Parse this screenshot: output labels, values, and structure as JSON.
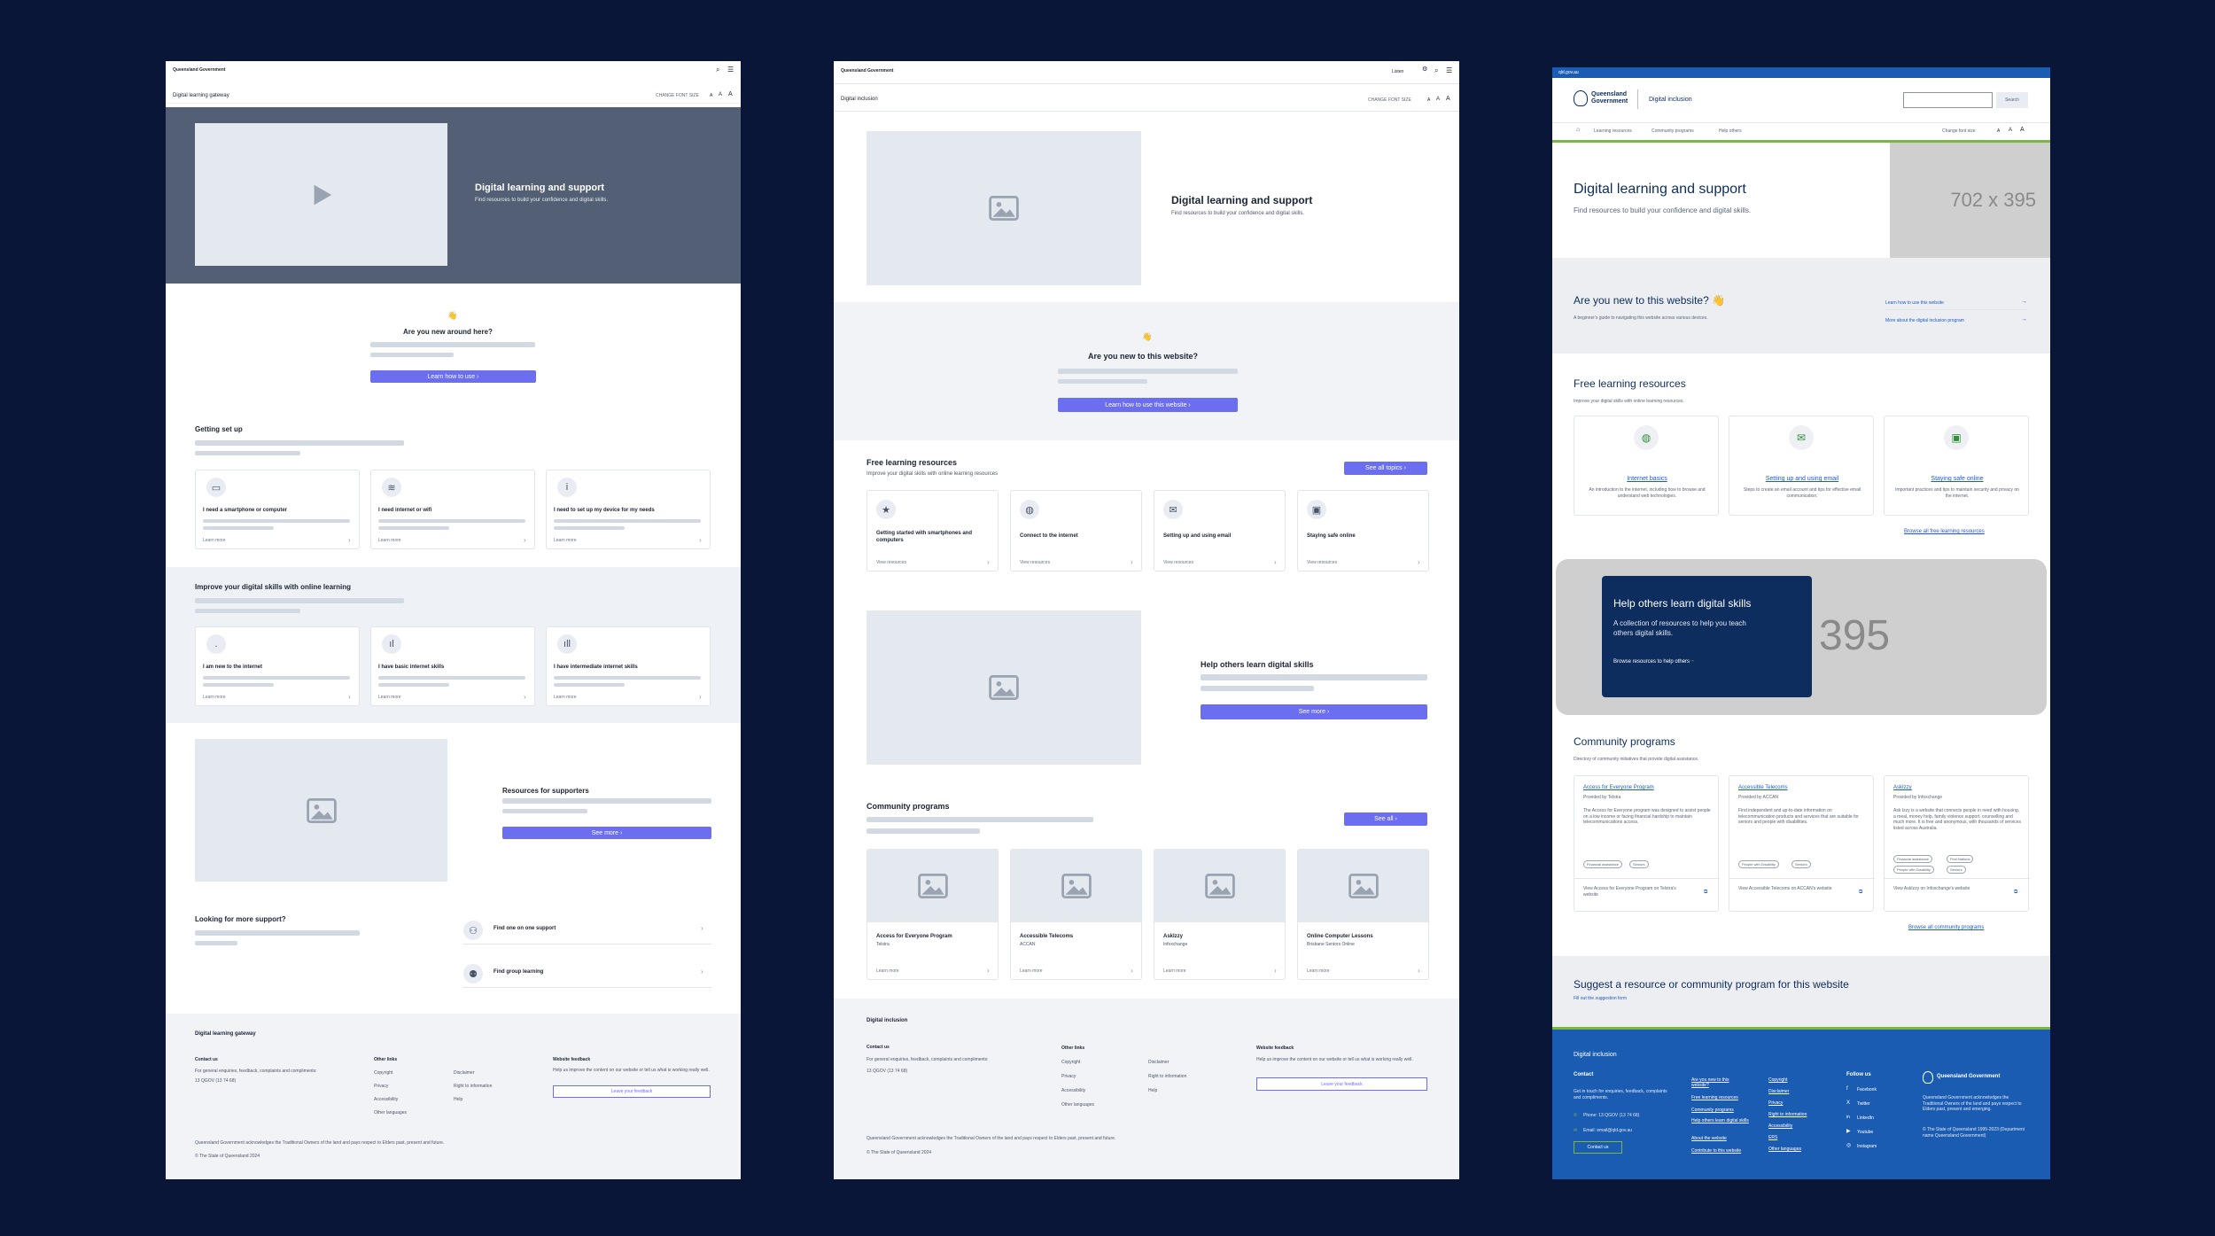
{
  "colors": {
    "background": "#0a1638",
    "accent": "#6c6ef0",
    "qld_blue": "#1b5cb3",
    "qld_navy": "#0c2d5e",
    "qld_green": "#78b843"
  },
  "icons": {
    "play": "play-icon",
    "image": "image-icon",
    "search": "search-icon",
    "menu": "menu-icon",
    "home": "home-icon"
  },
  "w1": {
    "logo": "Queensland Government",
    "site": "Digital learning gateway",
    "font_label": "CHANGE FONT SIZE",
    "font_a": [
      "A",
      "A",
      "A"
    ],
    "hero_title": "Digital learning and support",
    "hero_sub": "Find resources to build your confidence and digital skills.",
    "wave": "👋",
    "new_title": "Are you new around here?",
    "new_btn": "Learn how to use  ›",
    "setup_title": "Getting set up",
    "setup_cards": [
      {
        "label": "I need a smartphone or computer",
        "link": "Learn more"
      },
      {
        "label": "I need internet or wifi",
        "link": "Learn more"
      },
      {
        "label": "I need to set up my device for my needs",
        "link": "Learn more"
      }
    ],
    "improve_title": "Improve your digital skills with online learning",
    "improve_cards": [
      {
        "label": "I am new to the internet",
        "link": "Learn more"
      },
      {
        "label": "I have basic internet skills",
        "link": "Learn more"
      },
      {
        "label": "I have intermediate internet skills",
        "link": "Learn more"
      }
    ],
    "supporters_title": "Resources for supporters",
    "supporters_btn": "See more  ›",
    "more_title": "Looking for more support?",
    "support_links": [
      "Find one on one support",
      "Find group learning"
    ],
    "footer": {
      "site": "Digital learning gateway",
      "contact_h": "Contact us",
      "contact_text": "For general enquiries, feedback, complaints and compliments:",
      "phone": "13 QGOV (13 74 68)",
      "other_h": "Other links",
      "links_a": [
        "Copyright",
        "Privacy",
        "Accessibility",
        "Other languages"
      ],
      "links_b": [
        "Disclaimer",
        "Right to information",
        "Help"
      ],
      "feedback_h": "Website feedback",
      "feedback_text": "Help us improve the content on our website or tell us what is working really well.",
      "feedback_btn": "Leave your feedback",
      "ack": "Queensland Government acknowledges the Traditional Owners of the land and pays respect to Elders past, present and future.",
      "copy": "© The State of Queensland 2024"
    }
  },
  "w2": {
    "logo": "Queensland Government",
    "site": "Digital inclusion",
    "listen": "Listen",
    "font_label": "CHANGE FONT SIZE",
    "font_a": [
      "A",
      "A",
      "A"
    ],
    "hero_title": "Digital learning and support",
    "hero_sub": "Find resources to build your confidence and digital skills.",
    "wave": "👋",
    "new_title": "Are you new to this website?",
    "new_btn": "Learn how to use this website  ›",
    "free_title": "Free learning resources",
    "free_sub": "Improve your digital skills with online learning resources",
    "free_btn": "See all topics  ›",
    "free_cards": [
      {
        "label": "Getting started with smartphones and computers",
        "link": "View resources"
      },
      {
        "label": "Connect to the internet",
        "link": "View resources"
      },
      {
        "label": "Setting up and using email",
        "link": "View resources"
      },
      {
        "label": "Staying safe online",
        "link": "View resources"
      }
    ],
    "help_title": "Help others learn digital skills",
    "help_btn": "See more  ›",
    "comm_title": "Community programs",
    "comm_btn": "See all  ›",
    "comm_cards": [
      {
        "title": "Access for Everyone Program",
        "sub": "Telstra",
        "link": "Learn more"
      },
      {
        "title": "Accessible Telecoms",
        "sub": "ACCAN",
        "link": "Learn more"
      },
      {
        "title": "AskIzzy",
        "sub": "Infoxchange",
        "link": "Learn more"
      },
      {
        "title": "Online Computer Lessons",
        "sub": "Brisbane Seniors Online",
        "link": "Learn more"
      }
    ],
    "footer": {
      "site": "Digital inclusion",
      "contact_h": "Contact us",
      "contact_text": "For general enquiries, feedback, complaints and compliments:",
      "phone": "13 QGOV (13 74 68)",
      "other_h": "Other links",
      "links_a": [
        "Copyright",
        "Privacy",
        "Accessibility",
        "Other languages"
      ],
      "links_b": [
        "Disclaimer",
        "Right to information",
        "Help"
      ],
      "feedback_h": "Website feedback",
      "feedback_text": "Help us improve the content on our website or tell us what is working really well.",
      "feedback_btn": "Leave your feedback",
      "ack": "Queensland Government acknowledges the Traditional Owners of the land and pays respect to Elders past, present and future.",
      "copy": "© The State of Queensland 2024"
    }
  },
  "w3": {
    "topbar": "qld.gov.au",
    "logo": "Queensland Government",
    "site": "Digital inclusion",
    "search_btn": "Search",
    "nav": [
      "Learning resources",
      "Community programs",
      "Help others"
    ],
    "font_label": "Change font size",
    "font_a": [
      "A",
      "A",
      "A"
    ],
    "hero_title": "Digital learning and support",
    "hero_sub": "Find resources to build your confidence and digital skills.",
    "hero_ph": "702 x 395",
    "new_title": "Are you new to this website? 👋",
    "new_sub": "A beginner's guide to navigating this website across various devices.",
    "new_links": [
      "Learn how to use this website",
      "More about the digital inclusion program"
    ],
    "free_title": "Free learning resources",
    "free_sub": "Improve your digital skills with online learning resources.",
    "free_cards": [
      {
        "title": "Internet basics",
        "desc": "An introduction to the internet, including how to browse and understand web technologies."
      },
      {
        "title": "Setting up and using email",
        "desc": "Steps to create an email account and tips for effective email communication."
      },
      {
        "title": "Staying safe online",
        "desc": "Important practices and tips to maintain security and privacy on the internet."
      }
    ],
    "free_browse": "Browse all free learning resources",
    "help_title": "Help others learn digital skills",
    "help_sub": "A collection of resources to help you teach others digital skills.",
    "help_link": "Browse resources to help others",
    "help_ph": "395",
    "comm_title": "Community programs",
    "comm_sub": "Directory of community initiatives that provide digital assistance.",
    "comm_cards": [
      {
        "title": "Access for Everyone Program",
        "by": "Provided by Telstra",
        "desc": "The Access for Everyone program was designed to assist people on a low income or facing financial hardship to maintain telecommunications access.",
        "tags": [
          "Financial assistance",
          "Seniors"
        ],
        "link": "View Access for Everyone Program on Telstra's website"
      },
      {
        "title": "Accessible Telecoms",
        "by": "Provided by ACCAN",
        "desc": "Find independent and up-to-date information on telecommunication products and services that are suitable for seniors and people with disabilities.",
        "tags": [
          "People with Disability",
          "Seniors"
        ],
        "link": "View Accessible Telecoms on ACCAN's website"
      },
      {
        "title": "AskIzzy",
        "by": "Provided by Infoxchange",
        "desc": "Ask Izzy is a website that connects people in need with housing, a meal, money help, family violence support, counselling and much more. It is free and anonymous, with thousands of services listed across Australia.",
        "tags": [
          "Financial assistance",
          "First Nations",
          "People with Disability",
          "Seniors"
        ],
        "link": "View AskIzzy on Infoxchange's website"
      }
    ],
    "comm_browse": "Browse all community programs",
    "suggest_title": "Suggest a resource or community program for this website",
    "suggest_link": "Fill out the suggestion form",
    "footer": {
      "site": "Digital inclusion",
      "contact_h": "Contact",
      "contact_text": "Get in touch for enquiries, feedback, complaints and compliments.",
      "phone": "Phone: 13 QGOV (13 74 68)",
      "email": "Email: email@qld.gov.au",
      "contact_btn": "Contact us",
      "col_a": [
        "Are you new to this website?",
        "Free learning resources",
        "Community programs",
        "Help others learn digital skills",
        "About the website",
        "Contribute to this website"
      ],
      "col_b": [
        "Copyright",
        "Disclaimer",
        "Privacy",
        "Right to information",
        "Accessibility",
        "ERS",
        "Other languages"
      ],
      "follow_h": "Follow us",
      "social": [
        "Facebook",
        "Twitter",
        "LinkedIn",
        "Youtube",
        "Instagram"
      ],
      "logo": "Queensland Government",
      "ack": "Queensland Government acknowledges the Traditional Owners of the land and pays respect to Elders past, present and emerging.",
      "copy": "© The State of Queensland 1995-2023 (Department name Queensland Government)"
    }
  }
}
